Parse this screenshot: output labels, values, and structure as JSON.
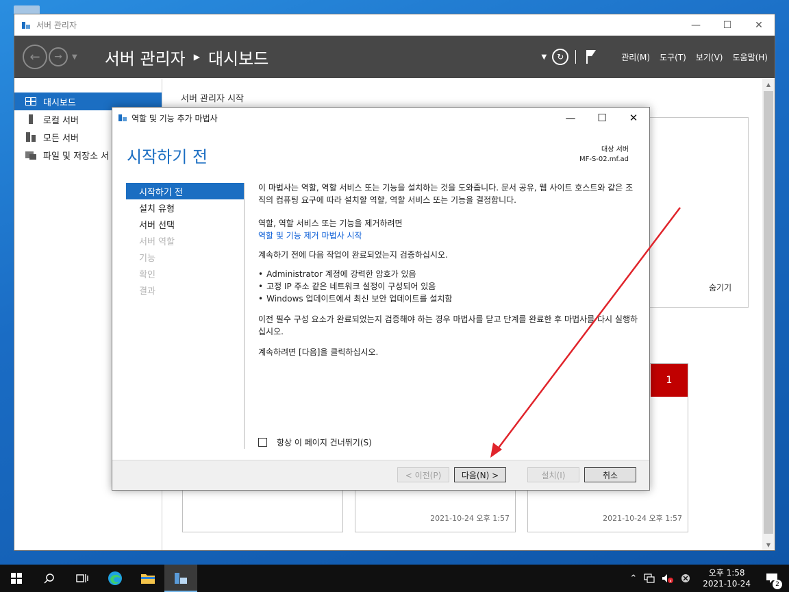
{
  "server_manager": {
    "title": "서버 관리자",
    "breadcrumb_root": "서버 관리자",
    "breadcrumb_current": "대시보드",
    "menu": [
      "관리(M)",
      "도구(T)",
      "보기(V)",
      "도움말(H)"
    ],
    "sidebar": [
      {
        "label": "대시보드",
        "icon": "dashboard-icon",
        "active": true
      },
      {
        "label": "로컬 서버",
        "icon": "local-server-icon",
        "active": false
      },
      {
        "label": "모든 서버",
        "icon": "all-servers-icon",
        "active": false
      },
      {
        "label": "파일 및 저장소 서",
        "icon": "file-storage-icon",
        "active": false
      }
    ],
    "main_heading": "서버 관리자 시작",
    "hide_label": "숨기기",
    "tile_badge": "1",
    "tile_times": [
      "2021-10-24 오후 1:57",
      "2021-10-24 오후 1:57"
    ]
  },
  "wizard": {
    "title": "역할 및 기능 추가 마법사",
    "heading": "시작하기 전",
    "dest_label": "대상 서버",
    "dest_server": "MF-S-02.mf.ad",
    "nav": [
      {
        "label": "시작하기 전",
        "state": "active"
      },
      {
        "label": "설치 유형",
        "state": "enabled"
      },
      {
        "label": "서버 선택",
        "state": "enabled"
      },
      {
        "label": "서버 역할",
        "state": "disabled"
      },
      {
        "label": "기능",
        "state": "disabled"
      },
      {
        "label": "확인",
        "state": "disabled"
      },
      {
        "label": "결과",
        "state": "disabled"
      }
    ],
    "intro": "이 마법사는 역할, 역할 서비스 또는 기능을 설치하는 것을 도와줍니다. 문서 공유, 웹 사이트 호스트와 같은 조직의 컴퓨팅 요구에 따라 설치할 역할, 역할 서비스 또는 기능을 결정합니다.",
    "remove_text": "역할, 역할 서비스 또는 기능을 제거하려면",
    "remove_link": "역할 및 기능 제거 마법사 시작",
    "verify_text": "계속하기 전에 다음 작업이 완료되었는지 검증하십시오.",
    "checklist": [
      "Administrator 계정에 강력한 암호가 있음",
      "고정 IP 주소 같은 네트워크 설정이 구성되어 있음",
      "Windows 업데이트에서 최신 보안 업데이트를 설치함"
    ],
    "prereq_text": "이전 필수 구성 요소가 완료되었는지 검증해야 하는 경우 마법사를 닫고 단계를 완료한 후 마법사를 다시 실행하십시오.",
    "continue_text": "계속하려면 [다음]을 클릭하십시오.",
    "skip_label": "항상 이 페이지 건너뛰기(S)",
    "buttons": {
      "prev": "< 이전(P)",
      "next": "다음(N) >",
      "install": "설치(I)",
      "cancel": "취소"
    }
  },
  "taskbar": {
    "time": "오후 1:58",
    "date": "2021-10-24",
    "notification_count": "2"
  },
  "colors": {
    "accent": "#1b6ec2",
    "toolbar": "#474747",
    "badge_red": "#c00000",
    "arrow": "#e0242b"
  }
}
